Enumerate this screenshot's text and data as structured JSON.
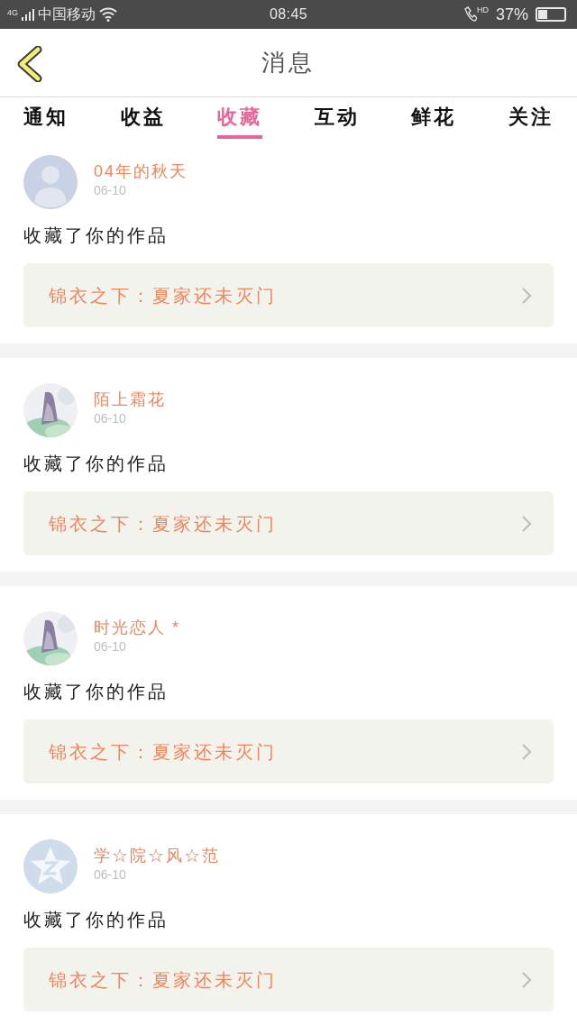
{
  "status_bar": {
    "carrier": "中国移动",
    "network": "4G",
    "time": "08:45",
    "call_badge": "HD",
    "battery_text": "37%"
  },
  "header": {
    "title": "消息"
  },
  "tabs": [
    {
      "label": "通知",
      "selected": false
    },
    {
      "label": "收益",
      "selected": false
    },
    {
      "label": "收藏",
      "selected": true
    },
    {
      "label": "互动",
      "selected": false
    },
    {
      "label": "鲜花",
      "selected": false
    },
    {
      "label": "关注",
      "selected": false
    }
  ],
  "messages": [
    {
      "avatar": {
        "kind": "default"
      },
      "name": "04年的秋天",
      "date": "06-10",
      "action": "收藏了你的作品",
      "work_title": "锦衣之下：夏家还未灭门"
    },
    {
      "name": "陌上霜花",
      "date": "06-10",
      "action": "收藏了你的作品",
      "work_title": "锦衣之下：夏家还未灭门"
    },
    {
      "name": "时光恋人 *",
      "date": "06-10",
      "action": "收藏了你的作品",
      "work_title": "锦衣之下：夏家还未灭门"
    },
    {
      "avatar": {
        "kind": "star"
      },
      "name": "学☆院☆风☆范",
      "date": "06-10",
      "action": "收藏了你的作品",
      "work_title": "锦衣之下：夏家还未灭门"
    }
  ]
}
